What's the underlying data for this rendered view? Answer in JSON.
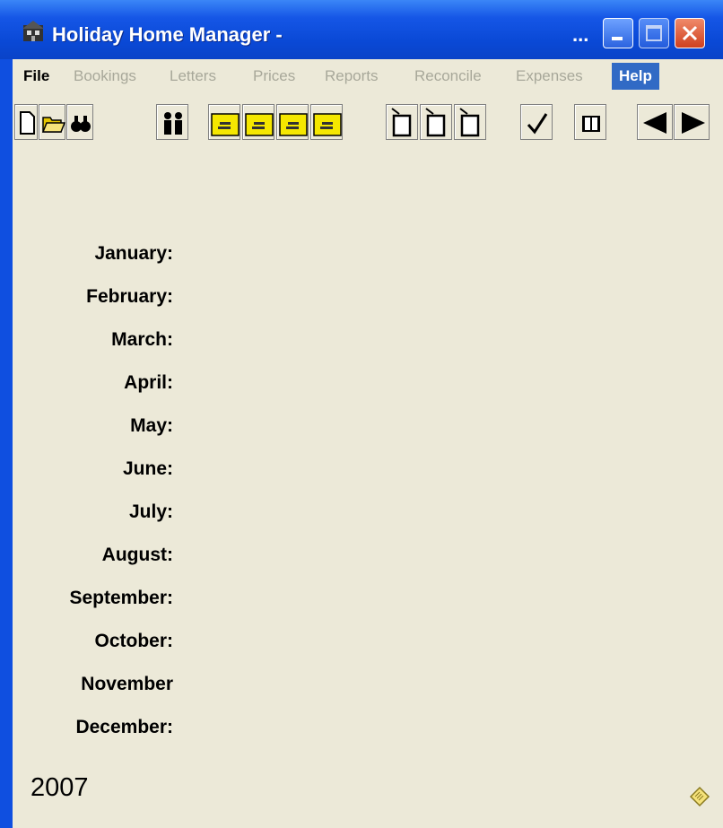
{
  "window": {
    "title": "Holiday Home Manager -",
    "title_overflow": "..."
  },
  "menu": {
    "items": [
      {
        "label": "File",
        "state": "active"
      },
      {
        "label": "Bookings",
        "state": "disabled"
      },
      {
        "label": "Letters",
        "state": "disabled"
      },
      {
        "label": "Prices",
        "state": "disabled"
      },
      {
        "label": "Reports",
        "state": "disabled"
      },
      {
        "label": "Reconcile",
        "state": "disabled"
      },
      {
        "label": "Expenses",
        "state": "disabled"
      },
      {
        "label": "Help",
        "state": "highlighted"
      }
    ]
  },
  "toolbar": {
    "icons": [
      "new-document-icon",
      "open-folder-icon",
      "find-binoculars-icon",
      "guests-people-icon",
      "booking-yellow-1-icon",
      "booking-yellow-2-icon",
      "booking-yellow-3-icon",
      "booking-yellow-4-icon",
      "letter-page-1-icon",
      "letter-page-2-icon",
      "letter-page-3-icon",
      "checkmark-icon",
      "book-icon",
      "previous-arrow-icon",
      "next-arrow-icon"
    ]
  },
  "calendar": {
    "months": [
      "January:",
      "February:",
      "March:",
      "April:",
      "May:",
      "June:",
      "July:",
      "August:",
      "September:",
      "October:",
      "November",
      "December:"
    ],
    "year": "2007"
  },
  "colors": {
    "title_bar": "#0a49d6",
    "face": "#ece9d8",
    "help_highlight": "#316ac5",
    "close_button": "#d0401e",
    "toolbar_yellow": "#f5e700"
  }
}
